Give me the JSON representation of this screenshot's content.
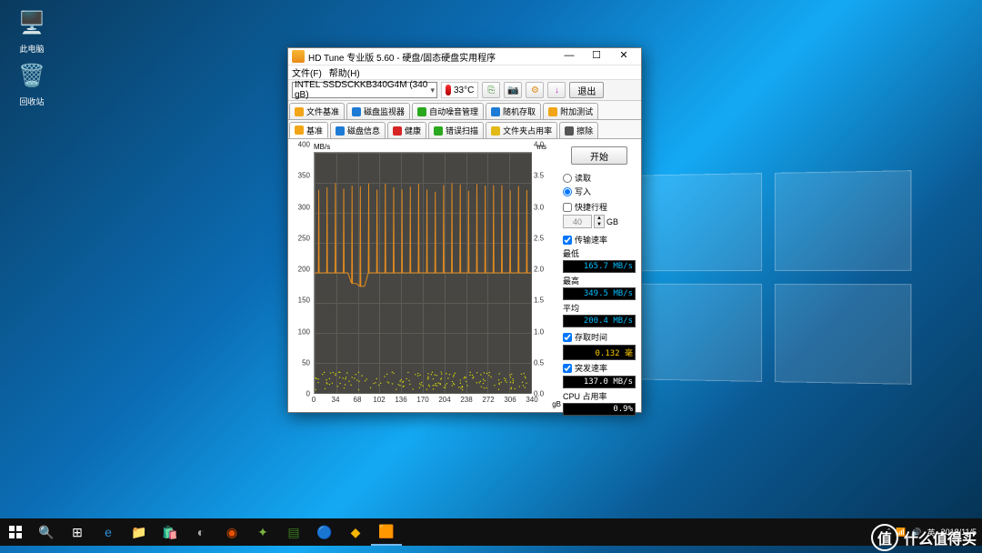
{
  "desktop": {
    "icons": {
      "pc": "此电脑",
      "recycle": "回收站"
    },
    "tray": {
      "ime": "英",
      "date": "2018/11/5"
    }
  },
  "watermark": {
    "badge": "值",
    "text": "什么值得买"
  },
  "app": {
    "title": "HD Tune 专业版 5.60 - 硬盘/固态硬盘实用程序",
    "menu": {
      "file": "文件(F)",
      "help": "帮助(H)"
    },
    "toolbar": {
      "drive": "INTEL SSDSCKKB340G4M (340 gB)",
      "temp": "33°C",
      "exit": "退出"
    },
    "tabs_top": [
      {
        "label": "文件基准",
        "color": "#f2a516"
      },
      {
        "label": "磁盘监视器",
        "color": "#1d7bd6"
      },
      {
        "label": "自动噪音管理",
        "color": "#2aa81e"
      },
      {
        "label": "随机存取",
        "color": "#1d7bd6"
      },
      {
        "label": "附加测试",
        "color": "#f2a516"
      }
    ],
    "tabs_bottom": [
      {
        "label": "基准",
        "color": "#f2a516",
        "active": true
      },
      {
        "label": "磁盘信息",
        "color": "#1d7bd6"
      },
      {
        "label": "健康",
        "color": "#d62424"
      },
      {
        "label": "错误扫描",
        "color": "#2aa81e"
      },
      {
        "label": "文件夹占用率",
        "color": "#e2b917"
      },
      {
        "label": "擦除",
        "color": "#555"
      }
    ],
    "side": {
      "start": "开始",
      "read": "读取",
      "write": "写入",
      "shortstroke": "快捷行程",
      "stroke_val": "40",
      "stroke_unit": "GB",
      "transfer": "传输速率",
      "min": "最低",
      "min_val": "165.7 MB/s",
      "max": "最高",
      "max_val": "349.5 MB/s",
      "avg": "平均",
      "avg_val": "200.4 MB/s",
      "access": "存取时间",
      "access_val": "0.132 毫",
      "burst": "突发速率",
      "burst_val": "137.0 MB/s",
      "cpu": "CPU 占用率",
      "cpu_val": "0.9%"
    }
  },
  "chart_data": {
    "type": "line",
    "title": "",
    "xlabel": "gB",
    "ylabel": "MB/s",
    "y2label": "ms",
    "xlim": [
      0,
      340
    ],
    "ylim": [
      0,
      400
    ],
    "y2lim": [
      0,
      4.0
    ],
    "xticks": [
      0,
      34,
      68,
      102,
      136,
      170,
      204,
      238,
      272,
      306,
      340
    ],
    "yticks": [
      0,
      50,
      100,
      150,
      200,
      250,
      300,
      350,
      400
    ],
    "y2ticks": [
      0,
      0.5,
      1.0,
      1.5,
      2.0,
      2.5,
      3.0,
      3.5,
      4.0
    ],
    "series": [
      {
        "name": "transfer_rate",
        "color": "#e38b1f",
        "baseline": 200,
        "spikes_to": 350,
        "spike_count": 26,
        "dip": {
          "x_start": 55,
          "x_end": 90,
          "to": 175
        }
      },
      {
        "name": "access_time_ms",
        "color": "#d6d60a",
        "approx": 0.13,
        "scatter_range": [
          0.05,
          0.35
        ]
      }
    ]
  }
}
